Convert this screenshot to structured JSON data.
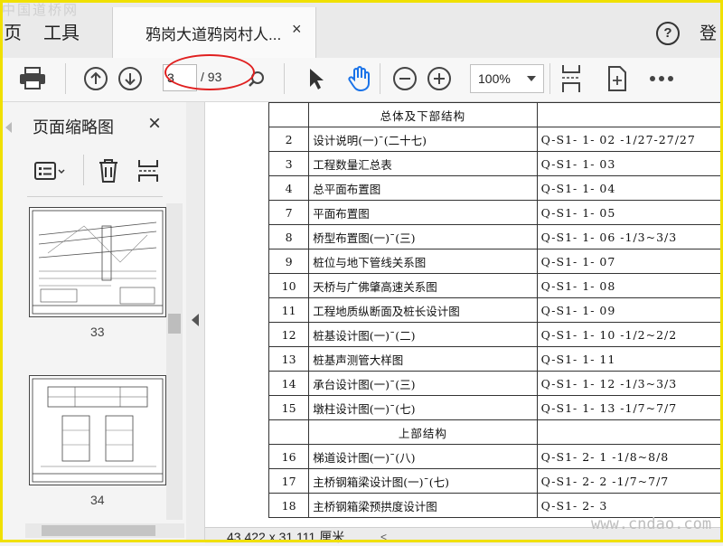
{
  "watermark": {
    "top": "中国道桥网",
    "bottom": "www.cndao.com"
  },
  "tabbar": {
    "home": "页",
    "tools": "工具",
    "doc_title": "鸦岗大道鸦岗村人...",
    "close": "×",
    "help": "?",
    "login": "登"
  },
  "toolbar": {
    "page_number": "3",
    "page_total": "/ 93",
    "zoom": "100%"
  },
  "thumb_panel": {
    "title": "页面缩略图",
    "close": "×",
    "thumbs": [
      {
        "label": "33"
      },
      {
        "label": "34"
      }
    ]
  },
  "table": {
    "section1": "总体及下部结构",
    "rows1": [
      {
        "no": "2",
        "name": "设计说明(一)¯(二十七)",
        "code": "Q-S1- 1- 02 -1/27-27/27"
      },
      {
        "no": "3",
        "name": "工程数量汇总表",
        "code": "Q-S1- 1- 03"
      },
      {
        "no": "4",
        "name": "总平面布置图",
        "code": "Q-S1- 1- 04"
      },
      {
        "no": "7",
        "name": "平面布置图",
        "code": "Q-S1- 1- 05"
      },
      {
        "no": "8",
        "name": "桥型布置图(一)¯(三)",
        "code": "Q-S1- 1- 06 -1/3~3/3"
      },
      {
        "no": "9",
        "name": "桩位与地下管线关系图",
        "code": "Q-S1- 1- 07"
      },
      {
        "no": "10",
        "name": "天桥与广佛肇高速关系图",
        "code": "Q-S1- 1- 08"
      },
      {
        "no": "11",
        "name": "工程地质纵断面及桩长设计图",
        "code": "Q-S1- 1- 09"
      },
      {
        "no": "12",
        "name": "桩基设计图(一)¯(二)",
        "code": "Q-S1- 1- 10 -1/2~2/2"
      },
      {
        "no": "13",
        "name": "桩基声测管大样图",
        "code": "Q-S1- 1- 11"
      },
      {
        "no": "14",
        "name": "承台设计图(一)¯(三)",
        "code": "Q-S1- 1- 12 -1/3~3/3"
      },
      {
        "no": "15",
        "name": "墩柱设计图(一)¯(七)",
        "code": "Q-S1- 1- 13 -1/7~7/7"
      }
    ],
    "section2": "上部结构",
    "rows2": [
      {
        "no": "16",
        "name": "梯道设计图(一)¯(八)",
        "code": "Q-S1- 2-  1 -1/8~8/8"
      },
      {
        "no": "17",
        "name": "主桥钢箱梁设计图(一)¯(七)",
        "code": "Q-S1- 2-  2 -1/7~7/7"
      },
      {
        "no": "18",
        "name": "主桥钢箱梁预拱度设计图",
        "code": "Q-S1- 2-  3"
      }
    ]
  },
  "status": {
    "dimensions": "43.422 x 31.111 厘米"
  }
}
